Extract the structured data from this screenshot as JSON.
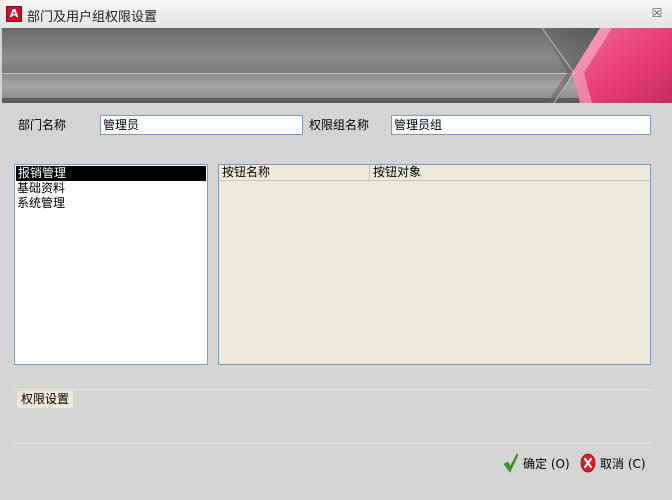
{
  "window": {
    "title": "部门及用户组权限设置",
    "app_icon_letter": "A",
    "close_glyph": "☒"
  },
  "form": {
    "department_label": "部门名称",
    "department_value": "管理员",
    "group_label": "权限组名称",
    "group_value": "管理员组"
  },
  "modules": {
    "items": [
      {
        "label": "报销管理",
        "selected": true
      },
      {
        "label": "基础资料",
        "selected": false
      },
      {
        "label": "系统管理",
        "selected": false
      }
    ]
  },
  "grid": {
    "columns": [
      "按钮名称",
      "按钮对象"
    ],
    "rows": []
  },
  "permissions": {
    "tab_label": "权限设置"
  },
  "buttons": {
    "ok_label": "确定 (O)",
    "cancel_label": "取消 (C)"
  },
  "colors": {
    "accent_pink": "#e8407a",
    "ok_green": "#3a9a1a",
    "cancel_red": "#d8202a"
  }
}
